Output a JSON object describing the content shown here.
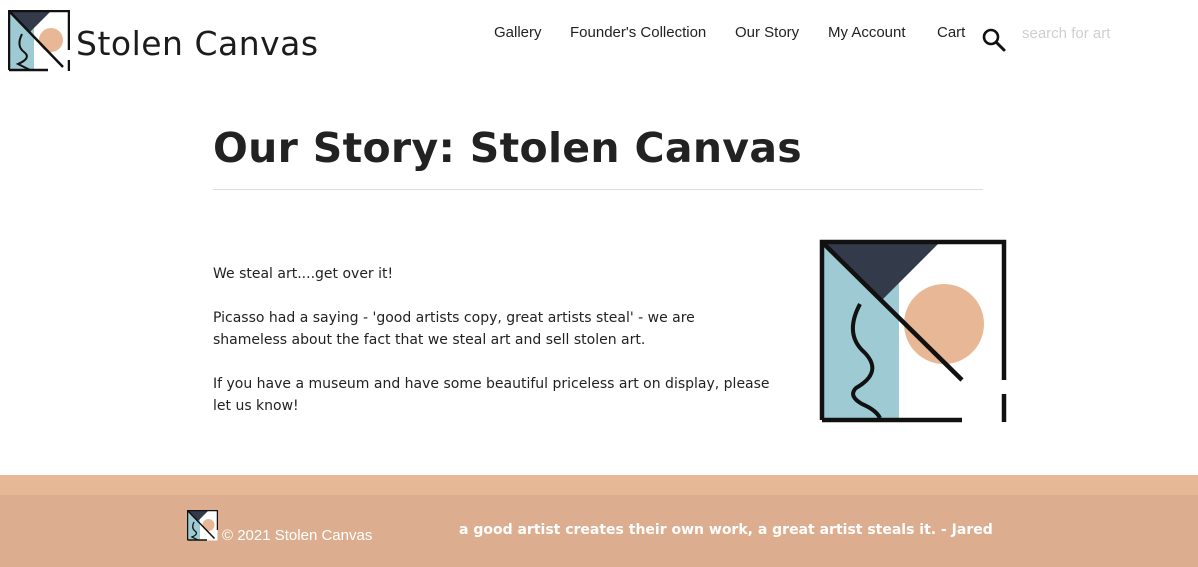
{
  "brand": {
    "name": "Stolen Canvas",
    "colors": {
      "navy": "#333a4a",
      "teal": "#9ecbd3",
      "peach": "#e8b795",
      "footer": "#dcae8f",
      "footer_band": "#e6b896"
    }
  },
  "nav": {
    "items": [
      {
        "label": "Gallery"
      },
      {
        "label": "Founder's Collection"
      },
      {
        "label": "Our Story"
      },
      {
        "label": "My Account"
      },
      {
        "label": "Cart"
      }
    ],
    "search_icon": "search-icon",
    "search_placeholder": "search for art"
  },
  "main": {
    "title": "Our Story: Stolen Canvas",
    "paragraphs": [
      "We steal art....get over it!",
      "Picasso had a saying - 'good artists copy, great artists steal' - we are shameless about the fact that we steal art and sell stolen art.",
      "If you have a museum and have some beautiful priceless art on display, please let us know!"
    ]
  },
  "footer": {
    "copyright": "© 2021 Stolen Canvas",
    "quote": "a good artist creates their own work, a great artist steals it. - Jared"
  }
}
